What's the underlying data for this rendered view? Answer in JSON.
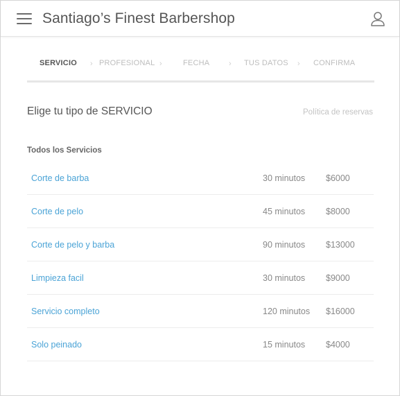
{
  "header": {
    "title": "Santiago’s Finest Barbershop",
    "menu_icon": "hamburger-menu-icon",
    "user_icon": "user-icon"
  },
  "steps": [
    {
      "label": "SERVICIO",
      "active": true
    },
    {
      "label": "PROFESIONAL",
      "active": false
    },
    {
      "label": "FECHA",
      "active": false
    },
    {
      "label": "TUS DATOS",
      "active": false
    },
    {
      "label": "CONFIRMA",
      "active": false
    }
  ],
  "step_separator": "›",
  "section": {
    "title": "Elige tu tipo de SERVICIO",
    "policy_link": "Política de reservas",
    "group_label": "Todos los Servicios"
  },
  "services": [
    {
      "name": "Corte de barba",
      "duration": "30 minutos",
      "price": "$6000"
    },
    {
      "name": "Corte de pelo",
      "duration": "45 minutos",
      "price": "$8000"
    },
    {
      "name": "Corte de pelo y barba",
      "duration": "90 minutos",
      "price": "$13000"
    },
    {
      "name": "Limpieza facil",
      "duration": "30 minutos",
      "price": "$9000"
    },
    {
      "name": "Servicio completo",
      "duration": "120 minutos",
      "price": "$16000"
    },
    {
      "name": "Solo peinado",
      "duration": "15 minutos",
      "price": "$4000"
    }
  ],
  "colors": {
    "link": "#4aa3d6",
    "active_step": "#555555",
    "inactive_step": "#bdbdbd"
  }
}
